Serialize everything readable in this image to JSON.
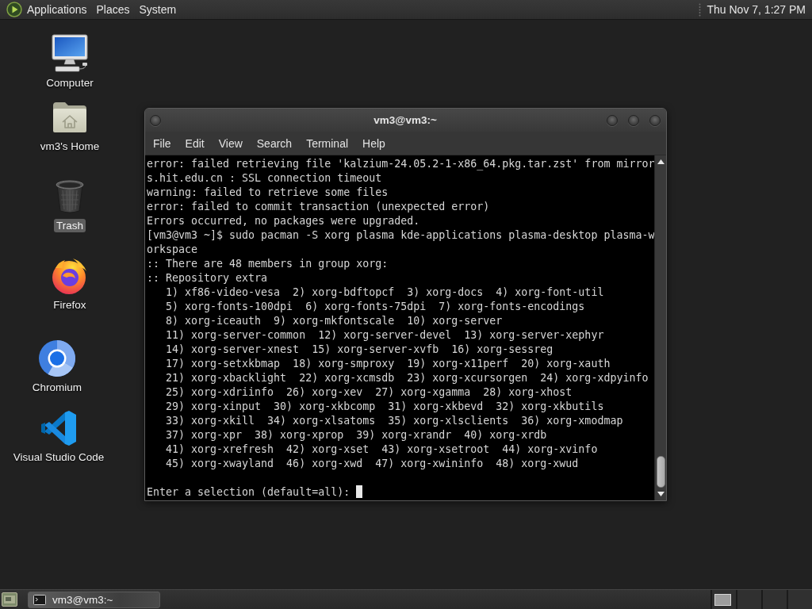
{
  "top_panel": {
    "menus": [
      "Applications",
      "Places",
      "System"
    ],
    "clock": "Thu Nov 7, 1:27 PM"
  },
  "desktop_icons": [
    {
      "kind": "monitor",
      "label": "Computer",
      "selected": false
    },
    {
      "kind": "home_folder",
      "label": "vm3's Home",
      "selected": false
    },
    {
      "kind": "trash",
      "label": "Trash",
      "selected": true
    },
    {
      "kind": "flame_globe",
      "label": "Firefox",
      "selected": false
    },
    {
      "kind": "ring",
      "label": "Chromium",
      "selected": false
    },
    {
      "kind": "ribbon",
      "label": "Visual Studio Code",
      "selected": false
    }
  ],
  "terminal_window": {
    "title": "vm3@vm3:~",
    "menu": [
      "File",
      "Edit",
      "View",
      "Search",
      "Terminal",
      "Help"
    ],
    "lines": [
      {
        "kind": "output",
        "text": "error: failed retrieving file 'kalzium-24.05.2-1-x86_64.pkg.tar.zst' from mirror"
      },
      {
        "kind": "output",
        "text": "s.hit.edu.cn : SSL connection timeout"
      },
      {
        "kind": "output",
        "text": "warning: failed to retrieve some files"
      },
      {
        "kind": "output",
        "text": "error: failed to commit transaction (unexpected error)"
      },
      {
        "kind": "output",
        "text": "Errors occurred, no packages were upgraded."
      },
      {
        "kind": "output",
        "text": "[vm3@vm3 ~]$ sudo pacman -S xorg plasma kde-applications plasma-desktop plasma-w"
      },
      {
        "kind": "output",
        "text": "orkspace"
      },
      {
        "kind": "output",
        "text": ":: There are 48 members in group xorg:"
      },
      {
        "kind": "output",
        "text": ":: Repository extra"
      },
      {
        "kind": "output",
        "text": "   1) xf86-video-vesa  2) xorg-bdftopcf  3) xorg-docs  4) xorg-font-util"
      },
      {
        "kind": "output",
        "text": "   5) xorg-fonts-100dpi  6) xorg-fonts-75dpi  7) xorg-fonts-encodings"
      },
      {
        "kind": "output",
        "text": "   8) xorg-iceauth  9) xorg-mkfontscale  10) xorg-server"
      },
      {
        "kind": "output",
        "text": "   11) xorg-server-common  12) xorg-server-devel  13) xorg-server-xephyr"
      },
      {
        "kind": "output",
        "text": "   14) xorg-server-xnest  15) xorg-server-xvfb  16) xorg-sessreg"
      },
      {
        "kind": "output",
        "text": "   17) xorg-setxkbmap  18) xorg-smproxy  19) xorg-x11perf  20) xorg-xauth"
      },
      {
        "kind": "output",
        "text": "   21) xorg-xbacklight  22) xorg-xcmsdb  23) xorg-xcursorgen  24) xorg-xdpyinfo"
      },
      {
        "kind": "output",
        "text": "   25) xorg-xdriinfo  26) xorg-xev  27) xorg-xgamma  28) xorg-xhost"
      },
      {
        "kind": "output",
        "text": "   29) xorg-xinput  30) xorg-xkbcomp  31) xorg-xkbevd  32) xorg-xkbutils"
      },
      {
        "kind": "output",
        "text": "   33) xorg-xkill  34) xorg-xlsatoms  35) xorg-xlsclients  36) xorg-xmodmap"
      },
      {
        "kind": "output",
        "text": "   37) xorg-xpr  38) xorg-xprop  39) xorg-xrandr  40) xorg-xrdb"
      },
      {
        "kind": "output",
        "text": "   41) xorg-xrefresh  42) xorg-xset  43) xorg-xsetroot  44) xorg-xvinfo"
      },
      {
        "kind": "output",
        "text": "   45) xorg-xwayland  46) xorg-xwd  47) xorg-xwininfo  48) xorg-xwud"
      },
      {
        "kind": "blank"
      },
      {
        "kind": "input",
        "text": "Enter a selection (default=all):"
      }
    ]
  },
  "taskbar": {
    "tasks": [
      {
        "label": "vm3@vm3:~"
      }
    ]
  }
}
